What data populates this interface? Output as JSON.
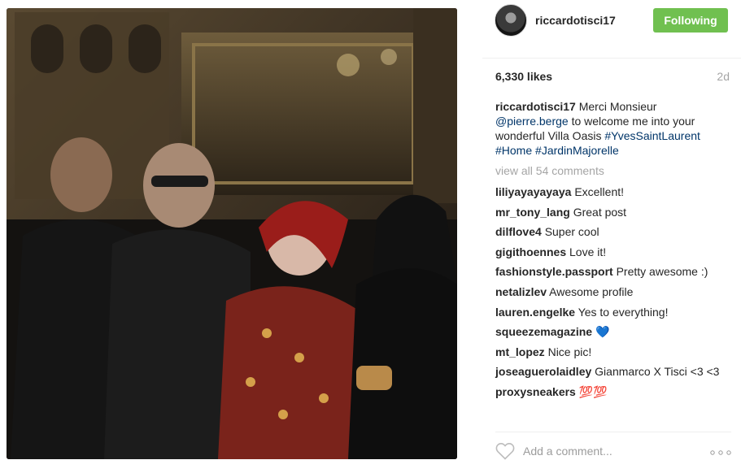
{
  "post": {
    "username": "riccardotisci17",
    "follow_label": "Following",
    "likes": "6,330 likes",
    "age": "2d",
    "caption": {
      "username": "riccardotisci17",
      "text_1": " Merci Monsieur ",
      "mention": "@pierre.berge",
      "text_2": " to welcome me into your wonderful Villa Oasis ",
      "tag_1": "#YvesSaintLaurent",
      "tag_2": "#Home",
      "tag_3": "#JardinMajorelle"
    },
    "view_all": "view all 54 comments",
    "comment_placeholder": "Add a comment..."
  },
  "comments": [
    {
      "user": "liliyayayayaya",
      "text": "Excellent!"
    },
    {
      "user": "mr_tony_lang",
      "text": "Great post"
    },
    {
      "user": "dilflove4",
      "text": "Super cool"
    },
    {
      "user": "gigithoennes",
      "text": "Love it!"
    },
    {
      "user": "fashionstyle.passport",
      "text": "Pretty awesome :)"
    },
    {
      "user": "netalizlev",
      "text": "Awesome profile"
    },
    {
      "user": "lauren.engelke",
      "text": "Yes to everything!"
    },
    {
      "user": "squeezemagazine",
      "text": "💙"
    },
    {
      "user": "mt_lopez",
      "text": "Nice pic!"
    },
    {
      "user": "joseaguerolaidley",
      "text": "Gianmarco X Tisci <3 <3"
    },
    {
      "user": "proxysneakers",
      "text": "💯💯"
    }
  ],
  "icons": {
    "heart": "heart-outline-icon",
    "more": "more-options-icon"
  },
  "colors": {
    "follow_button": "#70c050",
    "link": "#003569",
    "muted": "#a5a5a5"
  }
}
